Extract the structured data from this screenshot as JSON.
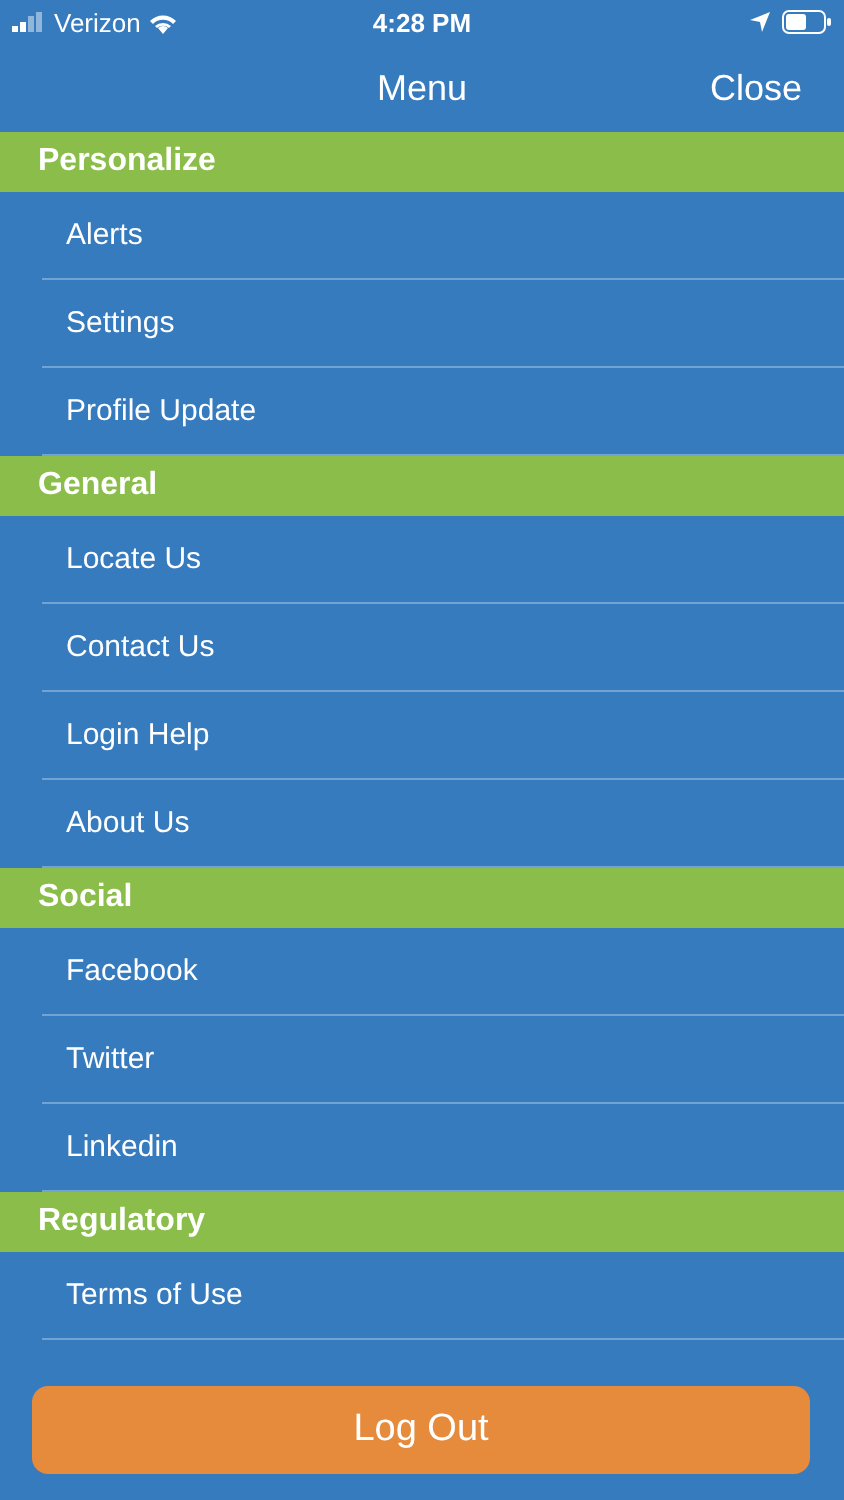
{
  "status_bar": {
    "carrier": "Verizon",
    "time": "4:28 PM"
  },
  "nav_bar": {
    "title": "Menu",
    "close": "Close"
  },
  "sections": [
    {
      "title": "Personalize",
      "items": [
        "Alerts",
        "Settings",
        "Profile Update"
      ]
    },
    {
      "title": "General",
      "items": [
        "Locate Us",
        "Contact Us",
        "Login Help",
        "About Us"
      ]
    },
    {
      "title": "Social",
      "items": [
        "Facebook",
        "Twitter",
        "Linkedin"
      ]
    },
    {
      "title": "Regulatory",
      "items": [
        "Terms of Use"
      ]
    }
  ],
  "logout_button": "Log Out"
}
